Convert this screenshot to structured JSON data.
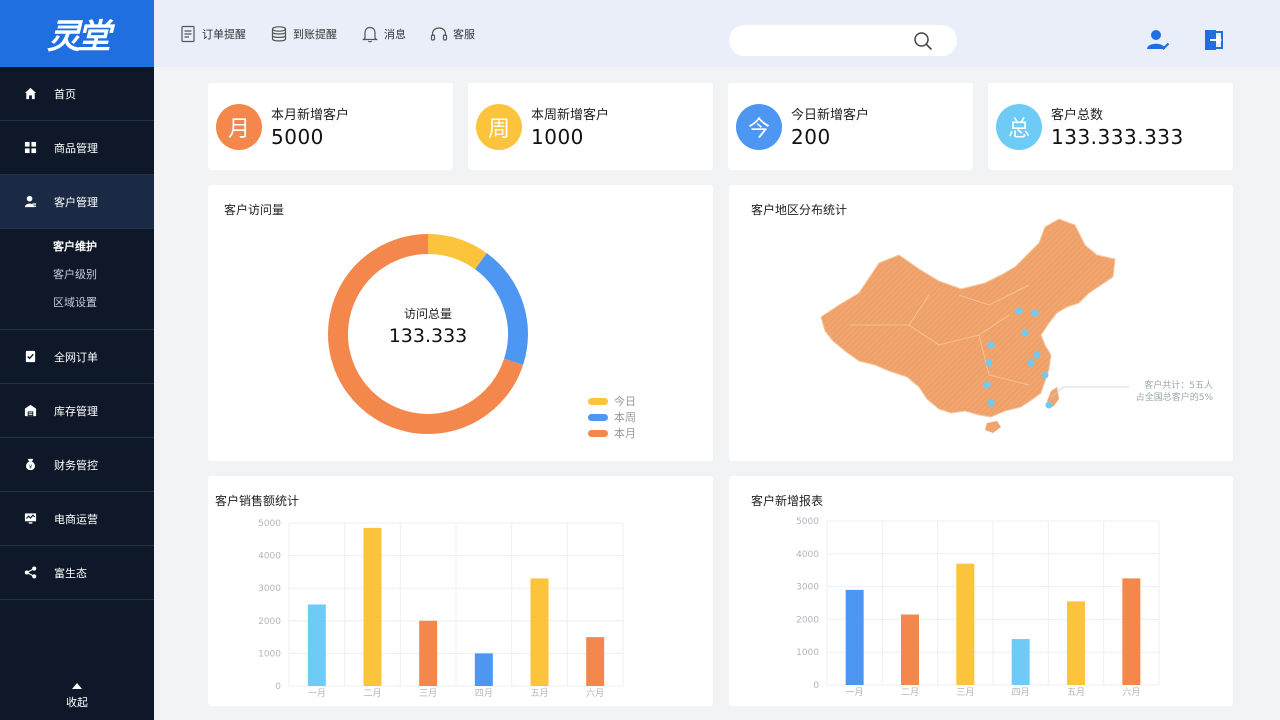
{
  "sidebar": {
    "logo_text": "灵堂",
    "items": [
      {
        "label": "首页",
        "icon": "home-icon"
      },
      {
        "label": "商品管理",
        "icon": "grid-icon"
      },
      {
        "label": "客户管理",
        "icon": "customer-icon"
      },
      {
        "label": "全网订单",
        "icon": "order-icon"
      },
      {
        "label": "库存管理",
        "icon": "warehouse-icon"
      },
      {
        "label": "财务管控",
        "icon": "money-bag-icon"
      },
      {
        "label": "电商运营",
        "icon": "monitor-icon"
      },
      {
        "label": "富生态",
        "icon": "share-icon"
      }
    ],
    "sub_items": [
      "客户维护",
      "客户级别",
      "区域设置"
    ],
    "collapse_label": "收起"
  },
  "topbar": {
    "links": [
      {
        "label": "订单提醒",
        "icon": "document-icon"
      },
      {
        "label": "到账提醒",
        "icon": "coins-icon"
      },
      {
        "label": "消息",
        "icon": "bell-icon"
      },
      {
        "label": "客服",
        "icon": "headset-icon"
      }
    ],
    "search_placeholder": "",
    "icons": [
      "user-verified-icon",
      "logout-icon"
    ]
  },
  "stats": [
    {
      "badge": "月",
      "label": "本月新增客户",
      "value": "5000",
      "color": "#f4884c"
    },
    {
      "badge": "周",
      "label": "本周新增客户",
      "value": "1000",
      "color": "#fcc33c"
    },
    {
      "badge": "今",
      "label": "今日新增客户",
      "value": "200",
      "color": "#4d97f2"
    },
    {
      "badge": "总",
      "label": "客户总数",
      "value": "133.333.333",
      "color": "#6ecbf5"
    }
  ],
  "visits": {
    "title": "客户访问量",
    "center_label": "访问总量",
    "center_value": "133.333",
    "legend": [
      {
        "label": "今日",
        "color": "#fcc33c"
      },
      {
        "label": "本周",
        "color": "#4d97f2"
      },
      {
        "label": "本月",
        "color": "#f4884c"
      }
    ]
  },
  "region": {
    "title": "客户地区分布统计",
    "note_line1": "客户共计：5五人",
    "note_line2": "占全国总客户的5%",
    "map_color": "#f1a56e"
  },
  "chart_data": [
    {
      "type": "donut",
      "title": "客户访问量",
      "categories": [
        "今日",
        "本周",
        "本月"
      ],
      "values": [
        10,
        20,
        70
      ],
      "colors": [
        "#fcc33c",
        "#4d97f2",
        "#f4884c"
      ]
    },
    {
      "type": "bar",
      "title": "客户销售额统计",
      "categories": [
        "一月",
        "二月",
        "三月",
        "四月",
        "五月",
        "六月"
      ],
      "values": [
        2500,
        4850,
        2000,
        1000,
        3300,
        1500
      ],
      "colors": [
        "#6ecbf5",
        "#fcc33c",
        "#f4884c",
        "#4d97f2",
        "#fcc33c",
        "#f4884c"
      ],
      "ylim": [
        0,
        5000
      ],
      "yticks": [
        "0",
        "1000",
        "2000",
        "3000",
        "4000",
        "5000"
      ],
      "grid": true
    },
    {
      "type": "bar",
      "title": "客户新增报表",
      "categories": [
        "一月",
        "二月",
        "三月",
        "四月",
        "五月",
        "六月"
      ],
      "values": [
        2900,
        2150,
        3700,
        1400,
        2550,
        3250
      ],
      "colors": [
        "#4d97f2",
        "#f4884c",
        "#fcc33c",
        "#6ecbf5",
        "#fcc33c",
        "#f4884c"
      ],
      "ylim": [
        0,
        5000
      ],
      "yticks": [
        "0",
        "1000",
        "2000",
        "3000",
        "4000",
        "5000"
      ],
      "grid": true
    }
  ]
}
